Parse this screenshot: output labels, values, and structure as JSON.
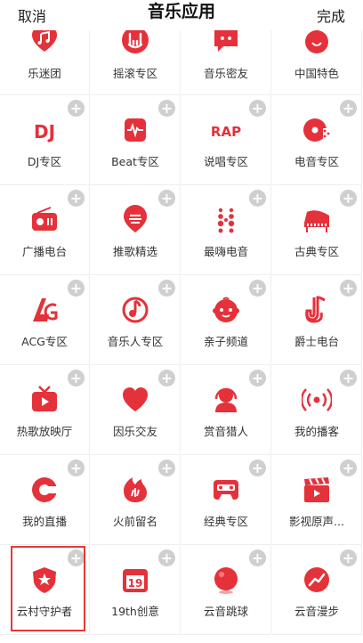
{
  "header": {
    "cancel_label": "取消",
    "title": "音乐应用",
    "done_label": "完成"
  },
  "accent_color": "#e5313a",
  "add_badge_glyph": "+",
  "rows": [
    [
      {
        "label": "乐迷团",
        "icon": "heart-music-icon"
      },
      {
        "label": "摇滚专区",
        "icon": "rock-hand-icon"
      },
      {
        "label": "音乐密友",
        "icon": "chat-friend-icon"
      },
      {
        "label": "中国特色",
        "icon": "china-flag-icon"
      }
    ],
    [
      {
        "label": "DJ专区",
        "icon": "dj-icon"
      },
      {
        "label": "Beat专区",
        "icon": "beat-icon"
      },
      {
        "label": "说唱专区",
        "icon": "rap-icon"
      },
      {
        "label": "电音专区",
        "icon": "electronic-disc-icon"
      }
    ],
    [
      {
        "label": "广播电台",
        "icon": "radio-icon"
      },
      {
        "label": "推歌精选",
        "icon": "recommend-icon"
      },
      {
        "label": "最嗨电音",
        "icon": "dots-grid-icon"
      },
      {
        "label": "古典专区",
        "icon": "piano-icon"
      }
    ],
    [
      {
        "label": "ACG专区",
        "icon": "acg-icon"
      },
      {
        "label": "音乐人专区",
        "icon": "musician-icon"
      },
      {
        "label": "亲子频道",
        "icon": "baby-icon"
      },
      {
        "label": "爵士电台",
        "icon": "saxophone-icon"
      }
    ],
    [
      {
        "label": "热歌放映厅",
        "icon": "tv-icon"
      },
      {
        "label": "因乐交友",
        "icon": "heart-icon"
      },
      {
        "label": "赏音猎人",
        "icon": "hunter-icon"
      },
      {
        "label": "我的播客",
        "icon": "podcast-icon"
      }
    ],
    [
      {
        "label": "我的直播",
        "icon": "live-icon"
      },
      {
        "label": "火前留名",
        "icon": "fire-icon"
      },
      {
        "label": "经典专区",
        "icon": "cassette-icon"
      },
      {
        "label": "影视原声...",
        "icon": "clapperboard-icon"
      }
    ],
    [
      {
        "label": "云村守护者",
        "icon": "shield-star-icon"
      },
      {
        "label": "19th创意",
        "icon": "19th-icon"
      },
      {
        "label": "云音跳球",
        "icon": "ball-icon"
      },
      {
        "label": "云音漫步",
        "icon": "trend-icon"
      }
    ]
  ]
}
